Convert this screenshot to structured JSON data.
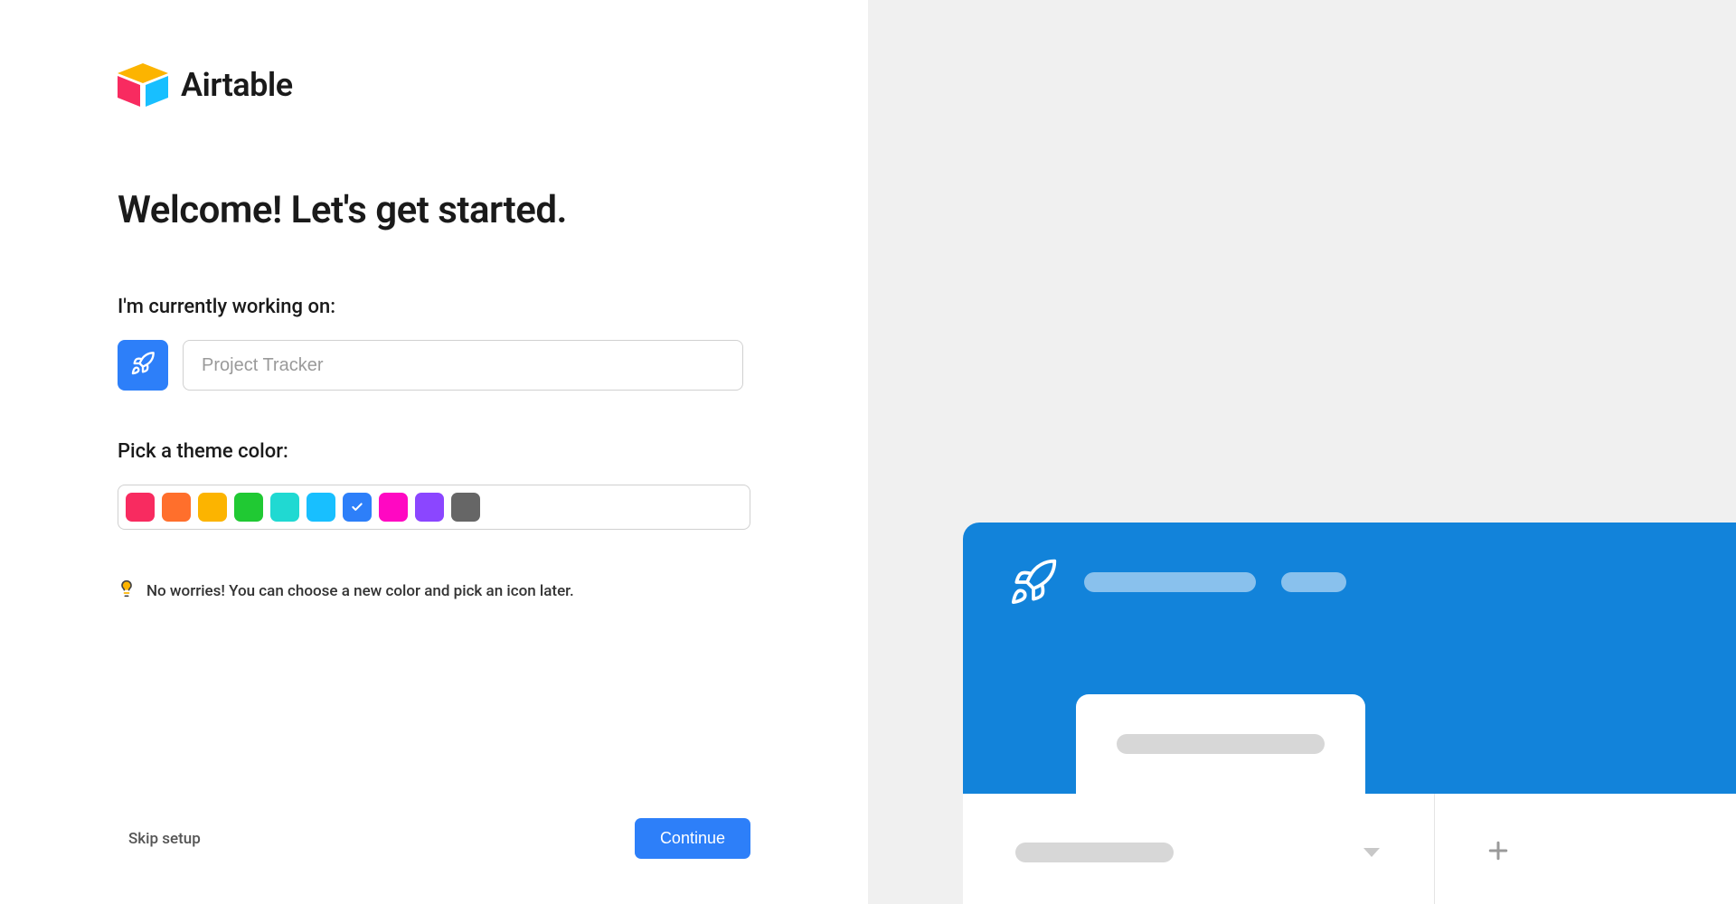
{
  "brand": {
    "name": "Airtable"
  },
  "headline": "Welcome! Let's get started.",
  "form": {
    "working_on_label": "I'm currently working on:",
    "project_placeholder": "Project Tracker",
    "theme_label": "Pick a theme color:",
    "colors": [
      {
        "name": "red",
        "hex": "#f82b60",
        "selected": false
      },
      {
        "name": "orange",
        "hex": "#ff6f2c",
        "selected": false
      },
      {
        "name": "yellow",
        "hex": "#fcb400",
        "selected": false
      },
      {
        "name": "green",
        "hex": "#20c933",
        "selected": false
      },
      {
        "name": "teal",
        "hex": "#20d9d2",
        "selected": false
      },
      {
        "name": "cyan",
        "hex": "#18bfff",
        "selected": false
      },
      {
        "name": "blue",
        "hex": "#2d7ff9",
        "selected": true
      },
      {
        "name": "pink",
        "hex": "#ff08c2",
        "selected": false
      },
      {
        "name": "purple",
        "hex": "#8b46ff",
        "selected": false
      },
      {
        "name": "gray",
        "hex": "#666666",
        "selected": false
      }
    ],
    "tip": "No worries! You can choose a new color and pick an icon later."
  },
  "footer": {
    "skip_label": "Skip setup",
    "continue_label": "Continue"
  }
}
